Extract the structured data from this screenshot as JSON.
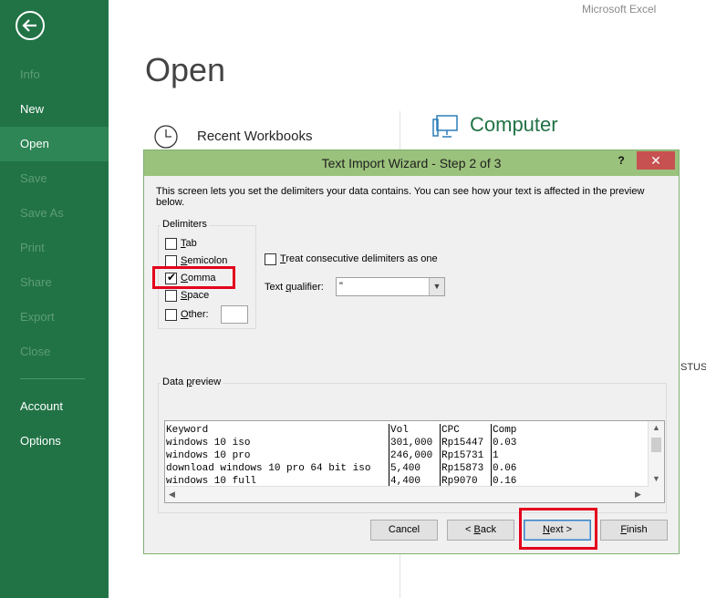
{
  "window": {
    "app_title": "Microsoft Excel"
  },
  "sidebar": {
    "back_icon": "back-arrow-icon",
    "items": [
      {
        "label": "Info",
        "state": "disabled"
      },
      {
        "label": "New",
        "state": "normal"
      },
      {
        "label": "Open",
        "state": "active"
      },
      {
        "label": "Save",
        "state": "disabled"
      },
      {
        "label": "Save As",
        "state": "disabled"
      },
      {
        "label": "Print",
        "state": "disabled"
      },
      {
        "label": "Share",
        "state": "disabled"
      },
      {
        "label": "Export",
        "state": "disabled"
      },
      {
        "label": "Close",
        "state": "disabled"
      },
      {
        "label": "Account",
        "state": "normal"
      },
      {
        "label": "Options",
        "state": "normal"
      }
    ]
  },
  "backstage": {
    "page_title": "Open",
    "recent_label": "Recent Workbooks",
    "recent_icon": "clock-icon",
    "computer_label": "Computer",
    "computer_icon": "computer-icon",
    "background_fragment": "STUS"
  },
  "dialog": {
    "title": "Text Import Wizard - Step 2 of 3",
    "help_label": "?",
    "close_icon": "close-icon",
    "description": "This screen lets you set the delimiters your data contains.  You can see how your text is affected in the preview below.",
    "delimiters": {
      "group_label": "Delimiters",
      "options": [
        {
          "label": "Tab",
          "accel": "T",
          "rest": "ab",
          "checked": false
        },
        {
          "label": "Semicolon",
          "accel": "S",
          "rest": "emicolon",
          "checked": false
        },
        {
          "label": "Comma",
          "accel": "C",
          "rest": "omma",
          "checked": true
        },
        {
          "label": "Space",
          "accel": "S",
          "rest": "pace",
          "checked": false
        },
        {
          "label": "Other:",
          "accel": "O",
          "rest": "ther:",
          "checked": false
        }
      ],
      "other_value": ""
    },
    "consecutive": {
      "accel": "T",
      "rest": "reat consecutive delimiters as one",
      "checked": false
    },
    "qualifier": {
      "label_pre": "Text ",
      "accel": "q",
      "label_post": "ualifier:",
      "value": "\""
    },
    "preview": {
      "label_pre": "Data ",
      "accel": "p",
      "label_post": "review",
      "columns": [
        "Keyword",
        "Vol",
        "CPC",
        "Comp"
      ],
      "rows": [
        [
          "windows 10 iso",
          "301,000",
          "Rp15447",
          "0.03"
        ],
        [
          "windows 10 pro",
          "246,000",
          "Rp15731",
          "1"
        ],
        [
          "download windows 10 pro 64 bit iso",
          "5,400",
          "Rp15873",
          "0.06"
        ],
        [
          "windows 10 full",
          "4,400",
          "Rp9070",
          "0.16"
        ]
      ]
    },
    "buttons": {
      "cancel": "Cancel",
      "back_pre": "< ",
      "back_accel": "B",
      "back_post": "ack",
      "next_accel": "N",
      "next_post": "ext >",
      "finish_accel": "F",
      "finish_post": "inish"
    }
  },
  "colors": {
    "sidebar": "#217346",
    "highlight": "#e4001b",
    "dialog_title": "#9bc27c"
  }
}
